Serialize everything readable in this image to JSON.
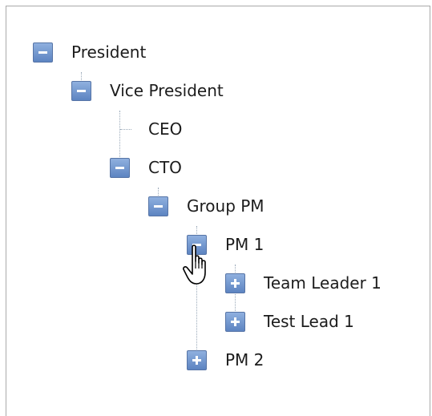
{
  "tree": {
    "nodes": [
      {
        "label": "President",
        "state": "expanded",
        "icon": "minus-icon"
      },
      {
        "label": "Vice President",
        "state": "expanded",
        "icon": "minus-icon"
      },
      {
        "label": "CEO",
        "state": "leaf",
        "icon": null
      },
      {
        "label": "CTO",
        "state": "expanded",
        "icon": "minus-icon"
      },
      {
        "label": "Group PM",
        "state": "expanded",
        "icon": "minus-icon"
      },
      {
        "label": "PM 1",
        "state": "expanded",
        "icon": "minus-icon"
      },
      {
        "label": "Team Leader 1",
        "state": "collapsed",
        "icon": "plus-icon"
      },
      {
        "label": "Test Lead 1",
        "state": "collapsed",
        "icon": "plus-icon"
      },
      {
        "label": "PM 2",
        "state": "collapsed",
        "icon": "plus-icon"
      }
    ]
  },
  "colors": {
    "toggle_fill_top": "#8fb0df",
    "toggle_fill_bottom": "#5d84c1",
    "toggle_border": "#5674a6",
    "connector_line": "#9aa9b9",
    "panel_border": "#a9a9a9"
  },
  "cursor": {
    "icon": "hand-pointer-icon"
  }
}
